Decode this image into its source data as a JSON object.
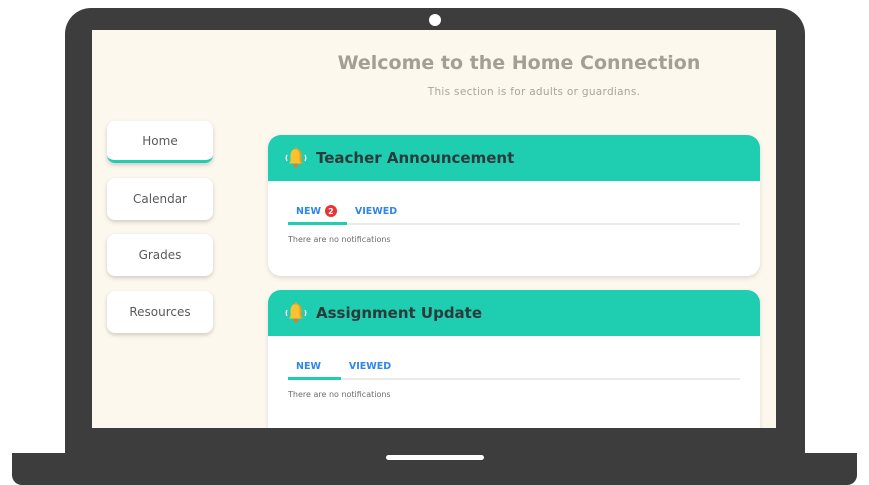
{
  "page": {
    "title": "Welcome to the Home Connection",
    "subtitle": "This section is for adults or guardians."
  },
  "sidebar": {
    "items": [
      {
        "label": "Home",
        "active": true
      },
      {
        "label": "Calendar",
        "active": false
      },
      {
        "label": "Grades",
        "active": false
      },
      {
        "label": "Resources",
        "active": false
      }
    ]
  },
  "cards": [
    {
      "title": "Teacher Announcement",
      "icon": "bell-ringing-icon",
      "tabs": [
        {
          "label": "NEW",
          "badge": "2",
          "active": true
        },
        {
          "label": "VIEWED",
          "active": false
        }
      ],
      "empty_message": "There are no notifications"
    },
    {
      "title": "Assignment Update",
      "icon": "bell-ringing-icon",
      "tabs": [
        {
          "label": "NEW",
          "active": true
        },
        {
          "label": "VIEWED",
          "active": false
        }
      ],
      "empty_message": "There are no notifications"
    }
  ],
  "colors": {
    "accent": "#1fcdb0",
    "tab_text": "#2e86e8",
    "badge": "#e73434",
    "screen_bg": "#fcf8ee",
    "frame": "#3d3d3d"
  }
}
